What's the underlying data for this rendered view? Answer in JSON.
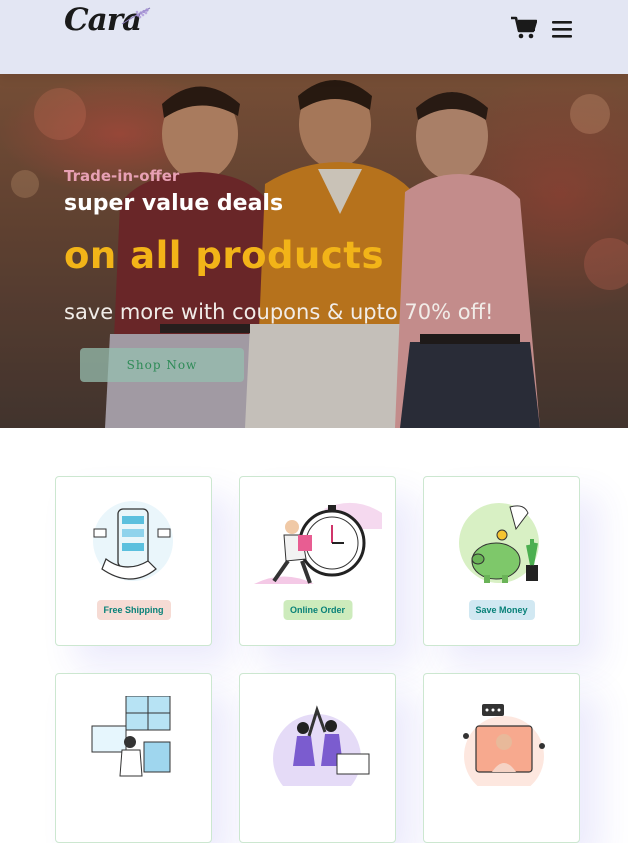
{
  "header": {
    "logo_text": "Cara",
    "icons": [
      "cart-icon",
      "menu-icon"
    ]
  },
  "hero": {
    "line1": "Trade-in-offer",
    "line2": "super value deals",
    "line3": "on all products",
    "line4": "save more with coupons & upto 70% off!",
    "button_label": "Shop Now"
  },
  "features": {
    "items": [
      {
        "label": "Free Shipping",
        "tag_color": "#f6dbd4",
        "icon": "phone-shipping-illustration"
      },
      {
        "label": "Online Order",
        "tag_color": "#cdebbc",
        "icon": "clock-runner-illustration"
      },
      {
        "label": "Save Money",
        "tag_color": "#d1e8f2",
        "icon": "piggy-bank-illustration"
      },
      {
        "label": "",
        "tag_color": "",
        "icon": "gift-delivery-illustration"
      },
      {
        "label": "",
        "tag_color": "",
        "icon": "team-highfive-illustration"
      },
      {
        "label": "",
        "tag_color": "",
        "icon": "online-support-illustration"
      }
    ]
  },
  "colors": {
    "header_bg": "#e3e6f3",
    "accent_yellow": "#f2b418",
    "accent_teal": "#088178"
  }
}
